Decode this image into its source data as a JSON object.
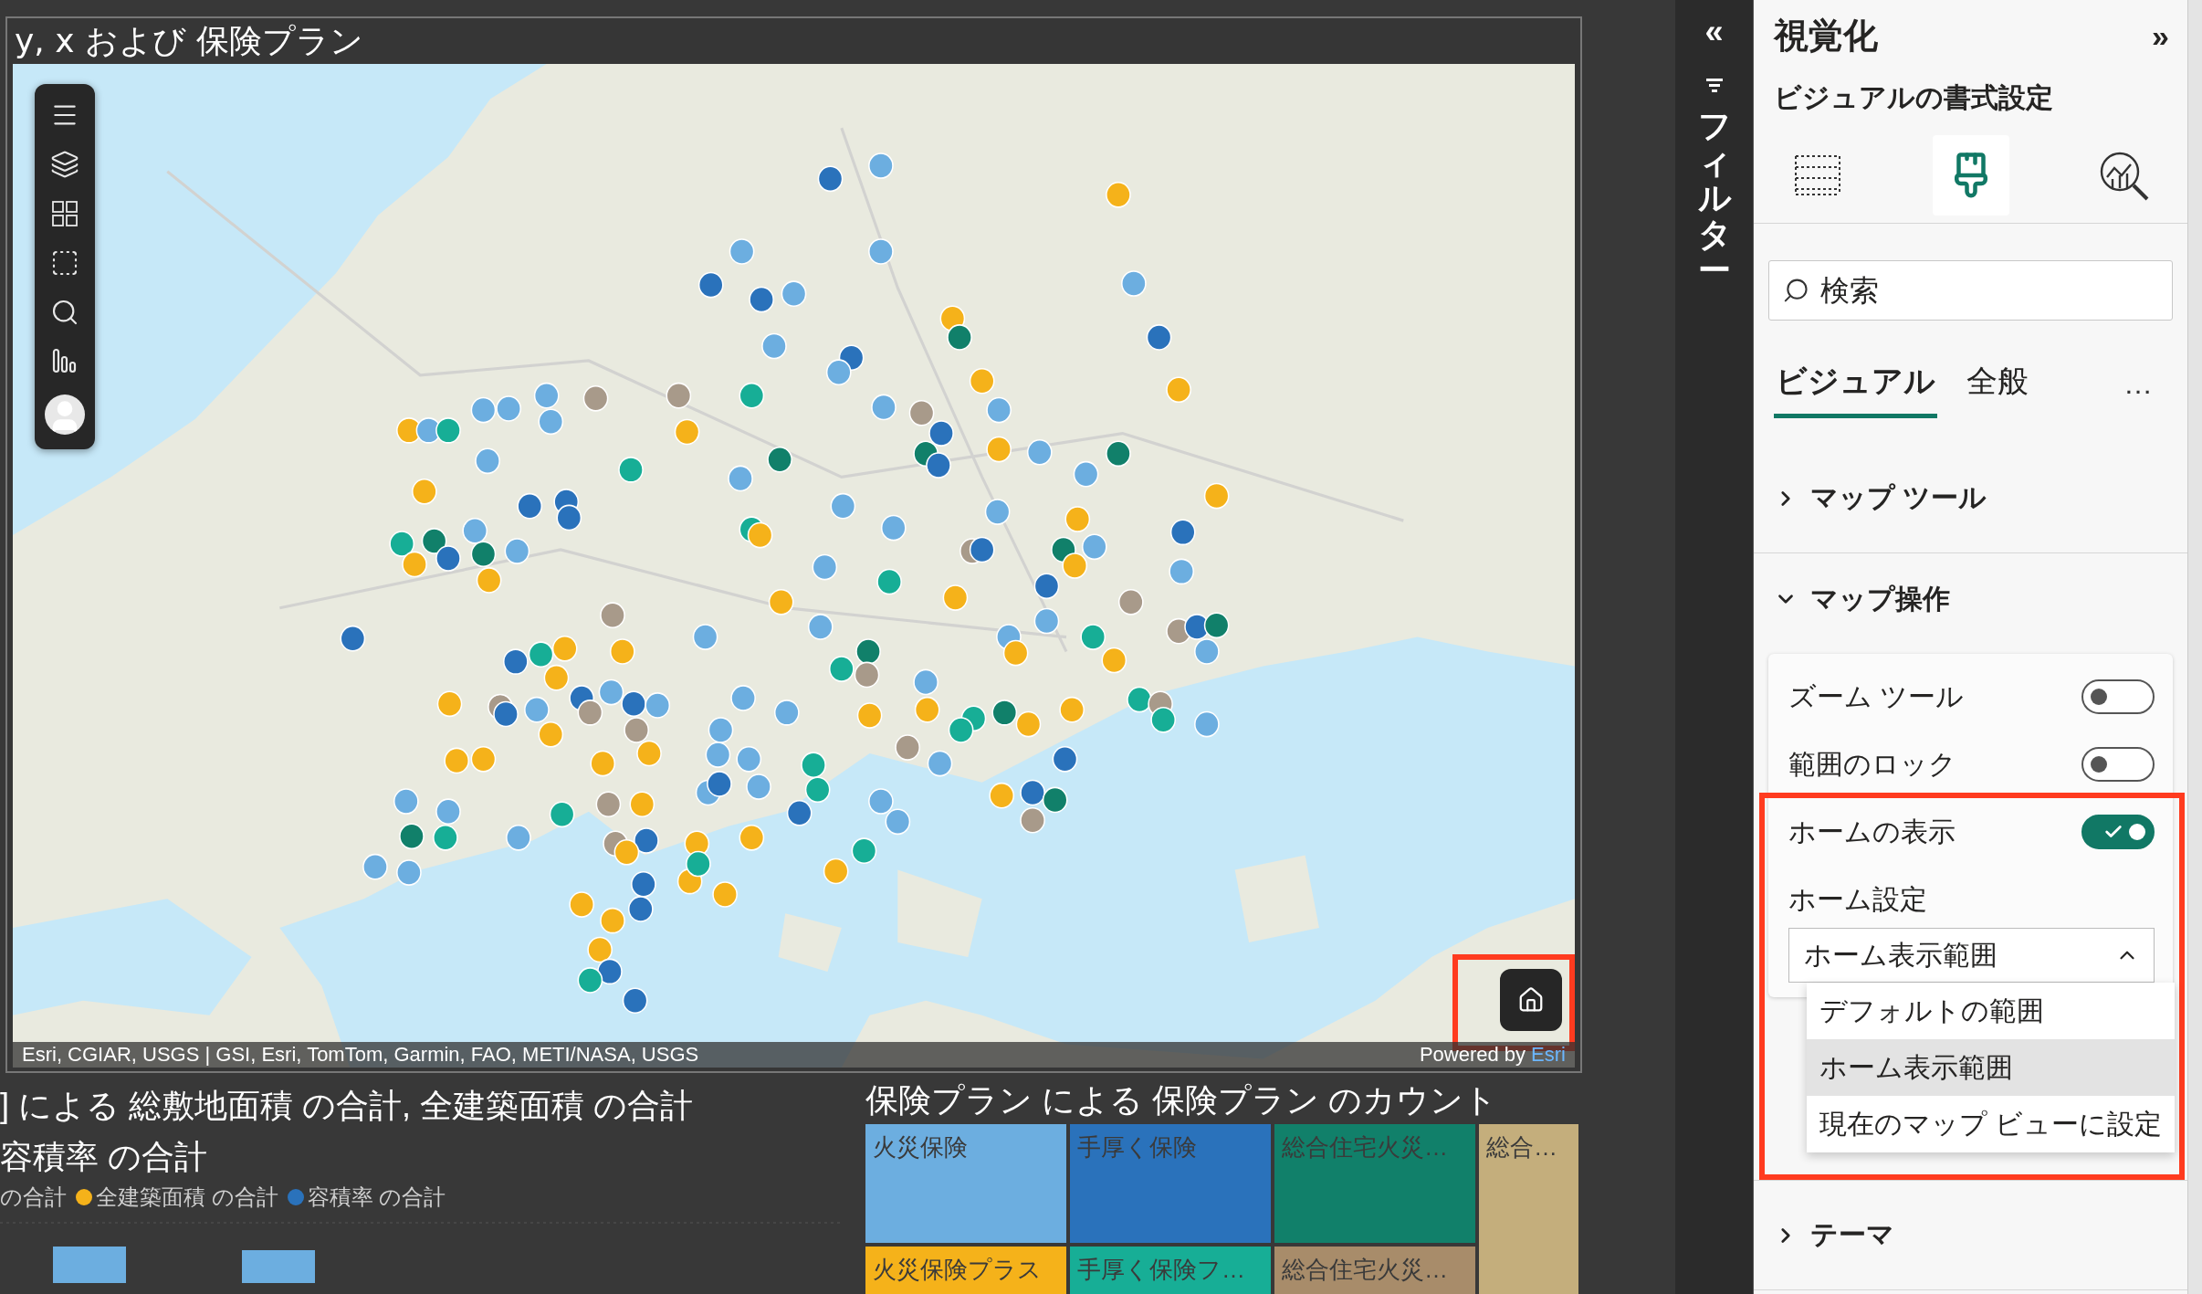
{
  "map_visual": {
    "title": "y, x および 保険プラン",
    "attribution": "Esri, CGIAR, USGS | GSI, Esri, TomTom, Garmin, FAO, METI/NASA, USGS",
    "powered_by": "Powered by",
    "powered_by_link": "Esri"
  },
  "bar_chart": {
    "title_lines": [
      "] による 総敷地面積 の合計, 全建築面積 の合計",
      "容積率 の合計"
    ],
    "legend": [
      {
        "label": "の合計"
      },
      {
        "label": "全建築面積 の合計",
        "color": "#f5b21a"
      },
      {
        "label": "容積率 の合計",
        "color": "#2a72bb"
      }
    ]
  },
  "treemap": {
    "title": "保険プラン による 保険プラン のカウント",
    "tiles": [
      {
        "label": "火災保険",
        "color": "#6caee0"
      },
      {
        "label": "火災保険プラス",
        "color": "#f5b21a"
      },
      {
        "label": "手厚く保険",
        "color": "#2a72bb"
      },
      {
        "label": "手厚く保険フ…",
        "color": "#17ae96"
      },
      {
        "label": "総合住宅火災…",
        "color": "#11806a"
      },
      {
        "label": "総合住宅火災…",
        "color": "#a88c6a"
      },
      {
        "label": "総合…",
        "color": "#c4ae7c"
      }
    ]
  },
  "filter_pane": {
    "collapse": "«",
    "title": "フィルター"
  },
  "visualizations": {
    "title": "視覚化",
    "expand": "»",
    "subtitle": "ビジュアルの書式設定",
    "view_tabs": [
      {
        "kind": "table",
        "selected": false
      },
      {
        "kind": "format",
        "selected": true
      },
      {
        "kind": "analytics",
        "selected": false
      }
    ],
    "search": {
      "placeholder": "検索"
    },
    "tabs": [
      {
        "label": "ビジュアル",
        "selected": true
      },
      {
        "label": "全般",
        "selected": false
      }
    ],
    "more": "…",
    "sections": [
      {
        "label": "マップ ツール",
        "expanded": false
      },
      {
        "label": "マップ操作",
        "expanded": true
      },
      {
        "label": "テーマ",
        "expanded": false
      }
    ],
    "map_operations": {
      "toggles": [
        {
          "label": "ズーム ツール",
          "on": false
        },
        {
          "label": "範囲のロック",
          "on": false
        },
        {
          "label": "ホームの表示",
          "on": true
        }
      ],
      "home_setting": {
        "label": "ホーム設定",
        "value": "ホーム表示範囲",
        "open": true,
        "options": [
          {
            "label": "デフォルトの範囲",
            "selected": false
          },
          {
            "label": "ホーム表示範囲",
            "selected": true
          },
          {
            "label": "現在のマップ ビューに設定",
            "selected": false
          }
        ]
      }
    }
  }
}
